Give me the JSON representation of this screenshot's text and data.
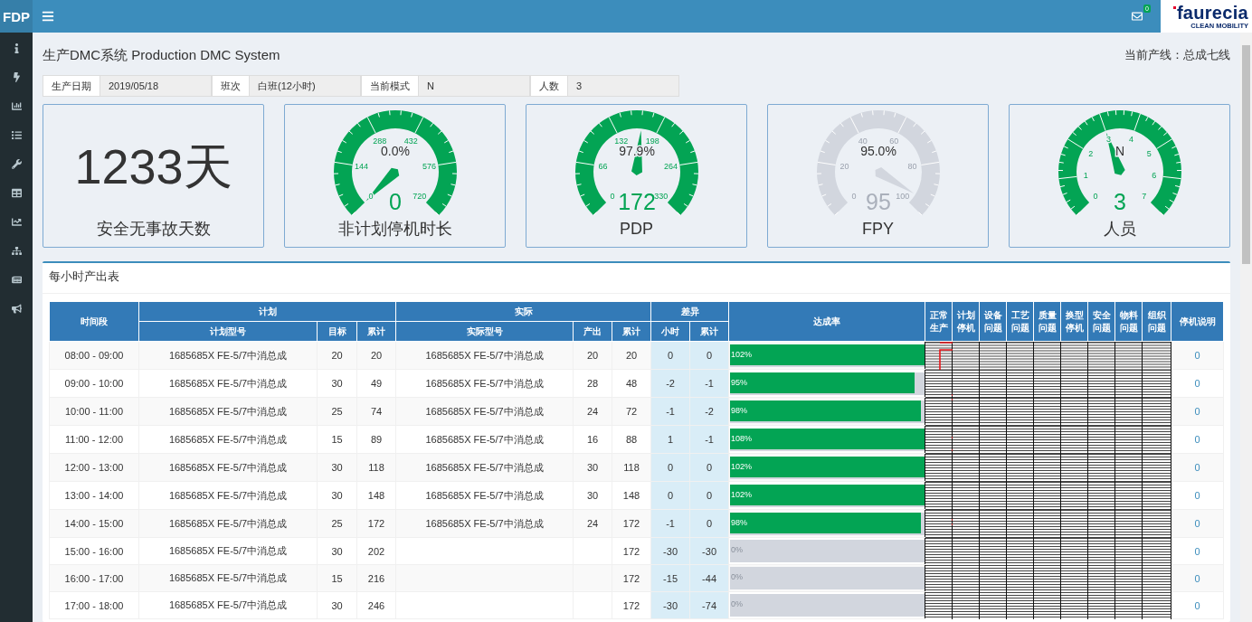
{
  "app": {
    "brand": "FDP",
    "mail_count": "0",
    "logo": {
      "name": "faurecia",
      "tagline": "CLEAN MOBILITY"
    }
  },
  "page": {
    "title": "生产DMC系统 Production DMC System",
    "line": "当前产线：总成七线"
  },
  "info": [
    {
      "label": "生产日期",
      "value": "2019/05/18"
    },
    {
      "label": "班次",
      "value": "白班(12小时)"
    },
    {
      "label": "当前模式",
      "value": "N"
    },
    {
      "label": "人数",
      "value": "3"
    }
  ],
  "kpis": [
    {
      "kind": "number",
      "value": "1233天",
      "title": "安全无事故天数"
    },
    {
      "kind": "gauge",
      "title": "非计划停机时长",
      "value": "0",
      "percent": "0.0%",
      "ticks": [
        "0",
        "144",
        "288",
        "432",
        "576",
        "720"
      ],
      "active": true
    },
    {
      "kind": "gauge",
      "title": "PDP",
      "value": "172",
      "percent": "97.9%",
      "ticks": [
        "0",
        "66",
        "132",
        "198",
        "264",
        "330"
      ],
      "active": true
    },
    {
      "kind": "gauge",
      "title": "FPY",
      "value": "95",
      "percent": "95.0%",
      "ticks": [
        "0",
        "20",
        "40",
        "60",
        "80",
        "100"
      ],
      "active": false
    },
    {
      "kind": "gauge",
      "title": "人员",
      "value": "3",
      "percent": "N",
      "ticks": [
        "0",
        "1",
        "2",
        "3",
        "4",
        "5",
        "6",
        "7"
      ],
      "active": true
    }
  ],
  "table": {
    "title": "每小时产出表",
    "columns": [
      {
        "label": "时间段"
      },
      {
        "label": "计划",
        "children": [
          {
            "label": "计划型号"
          },
          {
            "label": "目标"
          },
          {
            "label": "累计"
          }
        ]
      },
      {
        "label": "实际",
        "children": [
          {
            "label": "实际型号"
          },
          {
            "label": "产出"
          },
          {
            "label": "累计"
          }
        ]
      },
      {
        "label": "差异",
        "children": [
          {
            "label": "小时"
          },
          {
            "label": "累计"
          }
        ]
      },
      {
        "label": "达成率"
      },
      {
        "label": "正常生产"
      },
      {
        "label": "计划停机"
      },
      {
        "label": "设备问题"
      },
      {
        "label": "工艺问题"
      },
      {
        "label": "质量问题"
      },
      {
        "label": "换型停机"
      },
      {
        "label": "安全问题"
      },
      {
        "label": "物料问题"
      },
      {
        "label": "组织问题"
      },
      {
        "label": "停机说明"
      }
    ],
    "rows": [
      {
        "time": "08:00 - 09:00",
        "plan_model": "1685685X FE-5/7中消总成",
        "target": "20",
        "plan_total": "20",
        "actual_model": "1685685X FE-5/7中消总成",
        "output": "20",
        "actual_total": "20",
        "diff_hour": "0",
        "diff_total": "0",
        "rate": "102%",
        "level": 1,
        "note": "0"
      },
      {
        "time": "09:00 - 10:00",
        "plan_model": "1685685X FE-5/7中消总成",
        "target": "30",
        "plan_total": "49",
        "actual_model": "1685685X FE-5/7中消总成",
        "output": "28",
        "actual_total": "48",
        "diff_hour": "-2",
        "diff_total": "-1",
        "rate": "95%",
        "level": 0.95,
        "note": "0"
      },
      {
        "time": "10:00 - 11:00",
        "plan_model": "1685685X FE-5/7中消总成",
        "target": "25",
        "plan_total": "74",
        "actual_model": "1685685X FE-5/7中消总成",
        "output": "24",
        "actual_total": "72",
        "diff_hour": "-1",
        "diff_total": "-2",
        "rate": "98%",
        "level": 0.98,
        "note": "0"
      },
      {
        "time": "11:00 - 12:00",
        "plan_model": "1685685X FE-5/7中消总成",
        "target": "15",
        "plan_total": "89",
        "actual_model": "1685685X FE-5/7中消总成",
        "output": "16",
        "actual_total": "88",
        "diff_hour": "1",
        "diff_total": "-1",
        "rate": "108%",
        "level": 1,
        "note": "0"
      },
      {
        "time": "12:00 - 13:00",
        "plan_model": "1685685X FE-5/7中消总成",
        "target": "30",
        "plan_total": "118",
        "actual_model": "1685685X FE-5/7中消总成",
        "output": "30",
        "actual_total": "118",
        "diff_hour": "0",
        "diff_total": "0",
        "rate": "102%",
        "level": 1,
        "note": "0"
      },
      {
        "time": "13:00 - 14:00",
        "plan_model": "1685685X FE-5/7中消总成",
        "target": "30",
        "plan_total": "148",
        "actual_model": "1685685X FE-5/7中消总成",
        "output": "30",
        "actual_total": "148",
        "diff_hour": "0",
        "diff_total": "0",
        "rate": "102%",
        "level": 1,
        "note": "0"
      },
      {
        "time": "14:00 - 15:00",
        "plan_model": "1685685X FE-5/7中消总成",
        "target": "25",
        "plan_total": "172",
        "actual_model": "1685685X FE-5/7中消总成",
        "output": "24",
        "actual_total": "172",
        "diff_hour": "-1",
        "diff_total": "0",
        "rate": "98%",
        "level": 0.98,
        "note": "0"
      },
      {
        "time": "15:00 - 16:00",
        "plan_model": "1685685X FE-5/7中消总成",
        "target": "30",
        "plan_total": "202",
        "actual_total": "172",
        "diff_hour": "-30",
        "diff_total": "-30",
        "rate": "0%",
        "level": 0,
        "note": "0"
      },
      {
        "time": "16:00 - 17:00",
        "plan_model": "1685685X FE-5/7中消总成",
        "target": "15",
        "plan_total": "216",
        "actual_total": "172",
        "diff_hour": "-15",
        "diff_total": "-44",
        "rate": "0%",
        "level": 0,
        "note": "0"
      },
      {
        "time": "17:00 - 18:00",
        "plan_model": "1685685X FE-5/7中消总成",
        "target": "30",
        "plan_total": "246",
        "actual_total": "172",
        "diff_hour": "-30",
        "diff_total": "-74",
        "rate": "0%",
        "level": 0,
        "note": "0"
      }
    ]
  }
}
